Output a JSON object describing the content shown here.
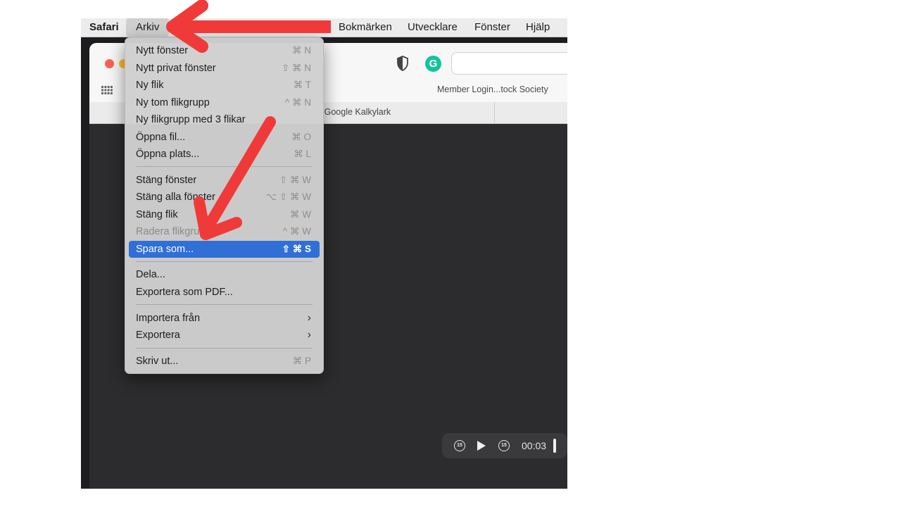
{
  "menubar": {
    "app": "Safari",
    "items": [
      "Arkiv",
      "Bokmärken",
      "Utvecklare",
      "Fönster",
      "Hjälp"
    ]
  },
  "browser": {
    "bookmark": "Member Login...tock Society",
    "tab_title": "- Google Kalkylark",
    "grammarly_letter": "G"
  },
  "file_menu": {
    "items": [
      {
        "label": "Nytt fönster",
        "shortcut": "⌘ N"
      },
      {
        "label": "Nytt privat fönster",
        "shortcut": "⇧ ⌘ N"
      },
      {
        "label": "Ny flik",
        "shortcut": "⌘ T"
      },
      {
        "label": "Ny tom flikgrupp",
        "shortcut": "^ ⌘ N"
      },
      {
        "label": "Ny flikgrupp med 3 flikar",
        "shortcut": ""
      },
      {
        "label": "Öppna fil...",
        "shortcut": "⌘ O"
      },
      {
        "label": "Öppna plats...",
        "shortcut": "⌘ L"
      },
      {
        "label": "Stäng fönster",
        "shortcut": "⇧ ⌘ W"
      },
      {
        "label": "Stäng alla fönster",
        "shortcut": "⌥ ⇧ ⌘ W"
      },
      {
        "label": "Stäng flik",
        "shortcut": "⌘ W"
      },
      {
        "label": "Radera flikgrupp",
        "shortcut": "^ ⌘ W",
        "disabled": true
      },
      {
        "label": "Spara som...",
        "shortcut": "⇧ ⌘ S",
        "highlighted": true
      },
      {
        "label": "Dela...",
        "shortcut": ""
      },
      {
        "label": "Exportera som PDF...",
        "shortcut": ""
      },
      {
        "label": "Importera från",
        "shortcut": "",
        "submenu": true
      },
      {
        "label": "Exportera",
        "shortcut": "",
        "submenu": true
      },
      {
        "label": "Skriv ut...",
        "shortcut": "⌘ P"
      }
    ]
  },
  "video": {
    "skip_back": "15",
    "skip_forward": "15",
    "time": "00:03"
  },
  "colors": {
    "highlight": "#2f6fd6",
    "arrow": "#f03a3a",
    "traffic_close": "#ff5f57",
    "traffic_min": "#febc2e"
  }
}
